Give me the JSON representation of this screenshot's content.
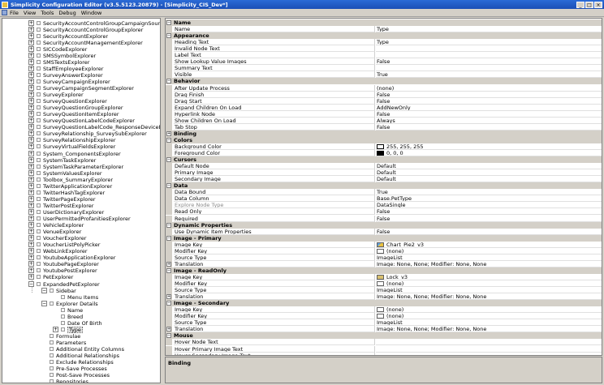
{
  "window": {
    "title": "Simplicity Configuration Editor (v3.5.5123.20879) - [Simplicity_CIS_Dev*]",
    "buttons": [
      "_",
      "□",
      "×"
    ]
  },
  "menu": [
    "File",
    "View",
    "Tools",
    "Debug",
    "Window"
  ],
  "tree": [
    {
      "label": "SecurityAccountControlGroupCampaignSourceListExplorer",
      "level": 0,
      "exp": "+"
    },
    {
      "label": "SecurityAccountControlGroupExplorer",
      "level": 0,
      "exp": "+"
    },
    {
      "label": "SecurityAccountExplorer",
      "level": 0,
      "exp": "+"
    },
    {
      "label": "SecurityAccountManagementExplorer",
      "level": 0,
      "exp": "+"
    },
    {
      "label": "SICCodeExplorer",
      "level": 0,
      "exp": "+"
    },
    {
      "label": "SMSSymbolExplorer",
      "level": 0,
      "exp": "+"
    },
    {
      "label": "SMSTextsExplorer",
      "level": 0,
      "exp": "+"
    },
    {
      "label": "StaffEmployeeExplorer",
      "level": 0,
      "exp": "+"
    },
    {
      "label": "SurveyAnswerExplorer",
      "level": 0,
      "exp": "+"
    },
    {
      "label": "SurveyCampaignExplorer",
      "level": 0,
      "exp": "+"
    },
    {
      "label": "SurveyCampaignSegmentExplorer",
      "level": 0,
      "exp": "+"
    },
    {
      "label": "SurveyExplorer",
      "level": 0,
      "exp": "+"
    },
    {
      "label": "SurveyQuestionExplorer",
      "level": 0,
      "exp": "+"
    },
    {
      "label": "SurveyQuestionGroupExplorer",
      "level": 0,
      "exp": "+"
    },
    {
      "label": "SurveyQuestionItemExplorer",
      "level": 0,
      "exp": "+"
    },
    {
      "label": "SurveyQuestionLabelCodeExplorer",
      "level": 0,
      "exp": "+"
    },
    {
      "label": "SurveyQuestionLabelCode_ResponseDeviceExplorer",
      "level": 0,
      "exp": "+"
    },
    {
      "label": "SurveyRelationship_SurveySubExplorer",
      "level": 0,
      "exp": "+"
    },
    {
      "label": "SurveyRelationshipExplorer",
      "level": 0,
      "exp": "+"
    },
    {
      "label": "SurveyVirtualFieldsExplorer",
      "level": 0,
      "exp": "+"
    },
    {
      "label": "System_ComponentsExplorer",
      "level": 0,
      "exp": "+"
    },
    {
      "label": "SystemTaskExplorer",
      "level": 0,
      "exp": "+"
    },
    {
      "label": "SystemTaskParameterExplorer",
      "level": 0,
      "exp": "+"
    },
    {
      "label": "SystemValuesExplorer",
      "level": 0,
      "exp": "+"
    },
    {
      "label": "Toolbox_SummaryExplorer",
      "level": 0,
      "exp": "+"
    },
    {
      "label": "TwitterApplicationExplorer",
      "level": 0,
      "exp": "+"
    },
    {
      "label": "TwitterHashTagExplorer",
      "level": 0,
      "exp": "+"
    },
    {
      "label": "TwitterPageExplorer",
      "level": 0,
      "exp": "+"
    },
    {
      "label": "TwitterPostExplorer",
      "level": 0,
      "exp": "+"
    },
    {
      "label": "UserDictionaryExplorer",
      "level": 0,
      "exp": "+"
    },
    {
      "label": "UserPermittedProfanitiesExplorer",
      "level": 0,
      "exp": "+"
    },
    {
      "label": "VehicleExplorer",
      "level": 0,
      "exp": "+"
    },
    {
      "label": "VenueExplorer",
      "level": 0,
      "exp": "+"
    },
    {
      "label": "VoucherExplorer",
      "level": 0,
      "exp": "+"
    },
    {
      "label": "VoucherListPolyPicker",
      "level": 0,
      "exp": "+"
    },
    {
      "label": "WebLinkExplorer",
      "level": 0,
      "exp": "+"
    },
    {
      "label": "YoutubeApplicationExplorer",
      "level": 0,
      "exp": "+"
    },
    {
      "label": "YoutubePageExplorer",
      "level": 0,
      "exp": "+"
    },
    {
      "label": "YoutubePostExplorer",
      "level": 0,
      "exp": "+"
    },
    {
      "label": "PetExplorer",
      "level": 0,
      "exp": "+"
    },
    {
      "label": "ExpandedPetExplorer",
      "level": 0,
      "exp": "−"
    },
    {
      "label": "Sidebar",
      "level": 1,
      "exp": "−"
    },
    {
      "label": "Menu Items",
      "level": 2,
      "exp": ""
    },
    {
      "label": "Explorer Details",
      "level": 1,
      "exp": "−"
    },
    {
      "label": "Name",
      "level": 2,
      "exp": ""
    },
    {
      "label": "Breed",
      "level": 2,
      "exp": ""
    },
    {
      "label": "Date Of Birth",
      "level": 2,
      "exp": ""
    },
    {
      "label": "Type",
      "level": 2,
      "exp": "+",
      "selected": true
    },
    {
      "label": "Formulae",
      "level": 1,
      "exp": ""
    },
    {
      "label": "Parameters",
      "level": 1,
      "exp": ""
    },
    {
      "label": "Additional Entity Columns",
      "level": 1,
      "exp": ""
    },
    {
      "label": "Additional Relationships",
      "level": 1,
      "exp": ""
    },
    {
      "label": "Exclude Relationships",
      "level": 1,
      "exp": ""
    },
    {
      "label": "Pre-Save Processes",
      "level": 1,
      "exp": ""
    },
    {
      "label": "Post-Save Processes",
      "level": 1,
      "exp": ""
    },
    {
      "label": "Repositories",
      "level": 1,
      "exp": ""
    }
  ],
  "properties": [
    {
      "cat": "Name"
    },
    {
      "name": "Name",
      "value": "Type"
    },
    {
      "cat": "Appearance"
    },
    {
      "name": "Heading Text",
      "value": "Type"
    },
    {
      "name": "Invalid Node Text",
      "value": ""
    },
    {
      "name": "Label Text",
      "value": ""
    },
    {
      "name": "Show Lookup Value Images",
      "value": "False"
    },
    {
      "name": "Summary Text",
      "value": ""
    },
    {
      "name": "Visible",
      "value": "True"
    },
    {
      "cat": "Behavior"
    },
    {
      "name": "After Update Process",
      "value": "(none)"
    },
    {
      "name": "Drag Finish",
      "value": "False"
    },
    {
      "name": "Drag Start",
      "value": "False"
    },
    {
      "name": "Expand Children On Load",
      "value": "AddNewOnly"
    },
    {
      "name": "Hyperlink Node",
      "value": "False"
    },
    {
      "name": "Show Children On Load",
      "value": "Always"
    },
    {
      "name": "Tab Stop",
      "value": "False"
    },
    {
      "cat": "Binding",
      "collapsed": true
    },
    {
      "cat": "Colors"
    },
    {
      "name": "Background Color",
      "value": "255, 255, 255",
      "swatch": "#ffffff"
    },
    {
      "name": "Foreground Color",
      "value": "0, 0, 0",
      "swatch": "#000000"
    },
    {
      "cat": "Cursors"
    },
    {
      "name": "Default Node",
      "value": "Default"
    },
    {
      "name": "Primary Image",
      "value": "Default"
    },
    {
      "name": "Secondary Image",
      "value": "Default"
    },
    {
      "cat": "Data"
    },
    {
      "name": "Data Bound",
      "value": "True"
    },
    {
      "name": "Data Column",
      "value": "Base.PetType"
    },
    {
      "name": "Explore Node Type",
      "value": "DataSingle",
      "dim": true
    },
    {
      "name": "Read Only",
      "value": "False"
    },
    {
      "name": "Required",
      "value": "False"
    },
    {
      "cat": "Dynamic Properties"
    },
    {
      "name": "Use Dynamic Item Properties",
      "value": "False"
    },
    {
      "cat": "Image - Primary"
    },
    {
      "name": "Image Key",
      "value": "Chart_Pie2_v3",
      "icon": "chart"
    },
    {
      "name": "Modifier Key",
      "value": "(none)",
      "icon": "none"
    },
    {
      "name": "Source Type",
      "value": "ImageList"
    },
    {
      "name": "Translation",
      "value": "Image: None, None; Modifier: None, None",
      "exp": true
    },
    {
      "cat": "Image - ReadOnly"
    },
    {
      "name": "Image Key",
      "value": "Lock_v3",
      "icon": "lock"
    },
    {
      "name": "Modifier Key",
      "value": "(none)",
      "icon": "none"
    },
    {
      "name": "Source Type",
      "value": "ImageList"
    },
    {
      "name": "Translation",
      "value": "Image: None, None; Modifier: None, None",
      "exp": true
    },
    {
      "cat": "Image - Secondary"
    },
    {
      "name": "Image Key",
      "value": "(none)",
      "icon": "none"
    },
    {
      "name": "Modifier Key",
      "value": "(none)",
      "icon": "none"
    },
    {
      "name": "Source Type",
      "value": "ImageList"
    },
    {
      "name": "Translation",
      "value": "Image: None, None; Modifier: None, None",
      "exp": true
    },
    {
      "cat": "Mouse"
    },
    {
      "name": "Hover Node Text",
      "value": ""
    },
    {
      "name": "Hover Primary Image Text",
      "value": ""
    },
    {
      "name": "Hover Secondary Image Text",
      "value": ""
    }
  ],
  "help": {
    "title": "Binding"
  }
}
